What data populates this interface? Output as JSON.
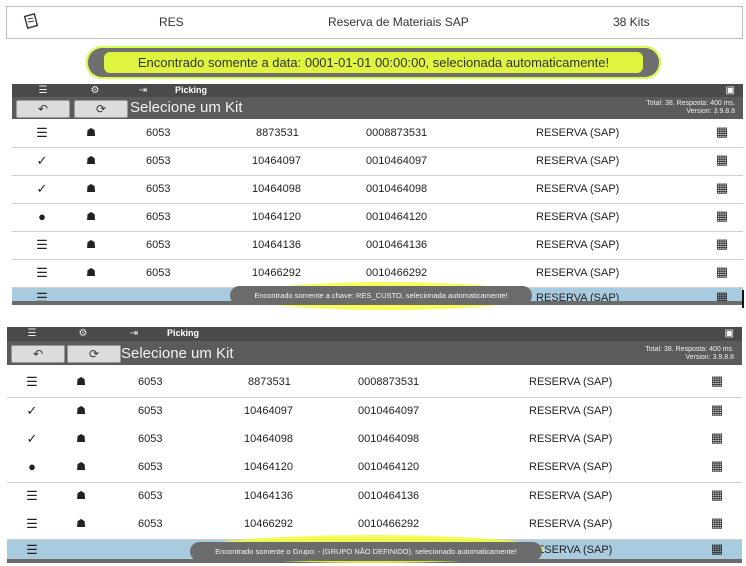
{
  "summary": {
    "doc_icon": "document-icon",
    "code": "RES",
    "description": "Reserva de Materiais SAP",
    "kits": "38 Kits"
  },
  "toast_top": {
    "text": "Encontrado somente a data: 0001-01-01 00:00:00, selecionada automaticamente!"
  },
  "app": {
    "menu_icon": "☰",
    "settings_icon": "⚙",
    "exit_icon": "⇥",
    "title": "Picking",
    "back_icon": "↶",
    "refresh_icon": "⟳",
    "page_title": "Selecione um Kit",
    "stats_total": "Total: 38. Resposta: 400 ms.",
    "stats_version": "Version: 3.9.8.8",
    "rows": [
      {
        "status": "☰",
        "user": "☗",
        "n": "6053",
        "code": "8873531",
        "code_full": "0008873531",
        "type": "RESERVA (SAP)",
        "box": "▦"
      },
      {
        "status": "✓",
        "user": "☗",
        "n": "6053",
        "code": "10464097",
        "code_full": "0010464097",
        "type": "RESERVA (SAP)",
        "box": "▦"
      },
      {
        "status": "✓",
        "user": "☗",
        "n": "6053",
        "code": "10464098",
        "code_full": "0010464098",
        "type": "RESERVA (SAP)",
        "box": "▦"
      },
      {
        "status": "●",
        "user": "☗",
        "n": "6053",
        "code": "10464120",
        "code_full": "0010464120",
        "type": "RESERVA (SAP)",
        "box": "▦"
      },
      {
        "status": "☰",
        "user": "☗",
        "n": "6053",
        "code": "10464136",
        "code_full": "0010464136",
        "type": "RESERVA (SAP)",
        "box": "▦"
      },
      {
        "status": "☰",
        "user": "☗",
        "n": "6053",
        "code": "10466292",
        "code_full": "0010466292",
        "type": "RESERVA (SAP)",
        "box": "▦"
      },
      {
        "status": "☰",
        "user": "",
        "n": "",
        "code": "",
        "code_full": "",
        "type": "RESERVA (SAP)",
        "box": "▦"
      }
    ]
  },
  "toast_chave": {
    "text": "Encontrado somente a chave: RES_CUSTO, selecionada automaticamente!"
  },
  "toast_grupo": {
    "text": "Encontrado somente o Grupo: - (GRUPO NÃO DEFINIDO), selecionado automaticamente!"
  }
}
